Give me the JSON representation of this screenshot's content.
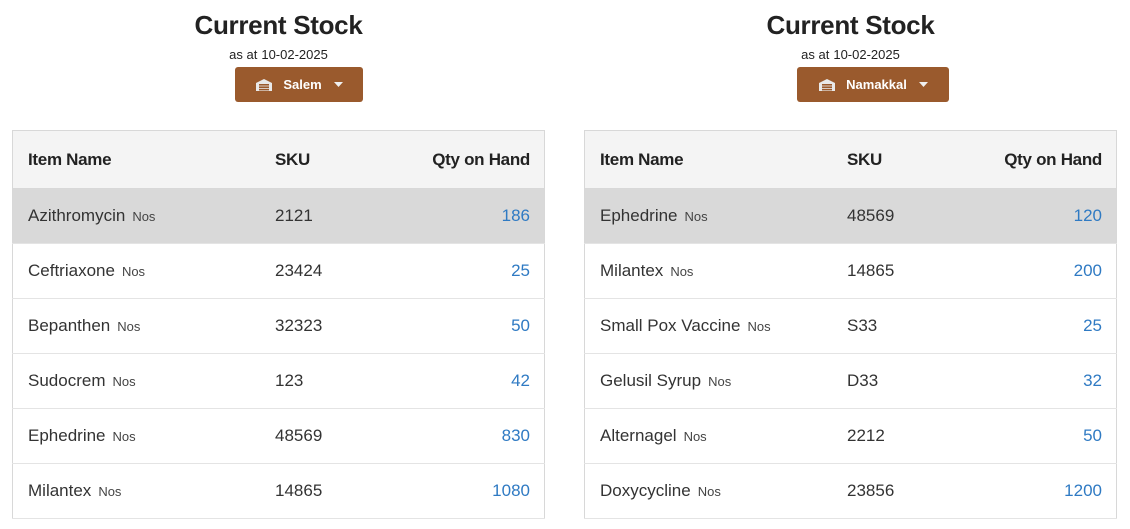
{
  "panels": [
    {
      "title": "Current Stock",
      "as_at_label": "as at",
      "as_at_date": "10-02-2025",
      "warehouse": "Salem",
      "warehouse_icon": "warehouse-icon",
      "caret_icon": "caret-down-icon",
      "columns": [
        "Item Name",
        "SKU",
        "Qty on Hand"
      ],
      "rows": [
        {
          "name": "Azithromycin",
          "unit": "Nos",
          "sku": "2121",
          "qty": "186"
        },
        {
          "name": "Ceftriaxone",
          "unit": "Nos",
          "sku": "23424",
          "qty": "25"
        },
        {
          "name": "Bepanthen",
          "unit": "Nos",
          "sku": "32323",
          "qty": "50"
        },
        {
          "name": "Sudocrem",
          "unit": "Nos",
          "sku": "123",
          "qty": "42"
        },
        {
          "name": "Ephedrine",
          "unit": "Nos",
          "sku": "48569",
          "qty": "830"
        },
        {
          "name": "Milantex",
          "unit": "Nos",
          "sku": "14865",
          "qty": "1080"
        }
      ]
    },
    {
      "title": "Current Stock",
      "as_at_label": "as at",
      "as_at_date": "10-02-2025",
      "warehouse": "Namakkal",
      "warehouse_icon": "warehouse-icon",
      "caret_icon": "caret-down-icon",
      "columns": [
        "Item Name",
        "SKU",
        "Qty on Hand"
      ],
      "rows": [
        {
          "name": "Ephedrine",
          "unit": "Nos",
          "sku": "48569",
          "qty": "120"
        },
        {
          "name": "Milantex",
          "unit": "Nos",
          "sku": "14865",
          "qty": "200"
        },
        {
          "name": "Small Pox Vaccine",
          "unit": "Nos",
          "sku": "S33",
          "qty": "25"
        },
        {
          "name": "Gelusil Syrup",
          "unit": "Nos",
          "sku": "D33",
          "qty": "32"
        },
        {
          "name": "Alternagel",
          "unit": "Nos",
          "sku": "2212",
          "qty": "50"
        },
        {
          "name": "Doxycycline",
          "unit": "Nos",
          "sku": "23856",
          "qty": "1200"
        }
      ]
    }
  ],
  "colors": {
    "button_bg": "#9a5a2d",
    "qty_link": "#2f7ac3",
    "header_bg": "#f4f4f4",
    "highlight_row": "#d9d9d9"
  }
}
